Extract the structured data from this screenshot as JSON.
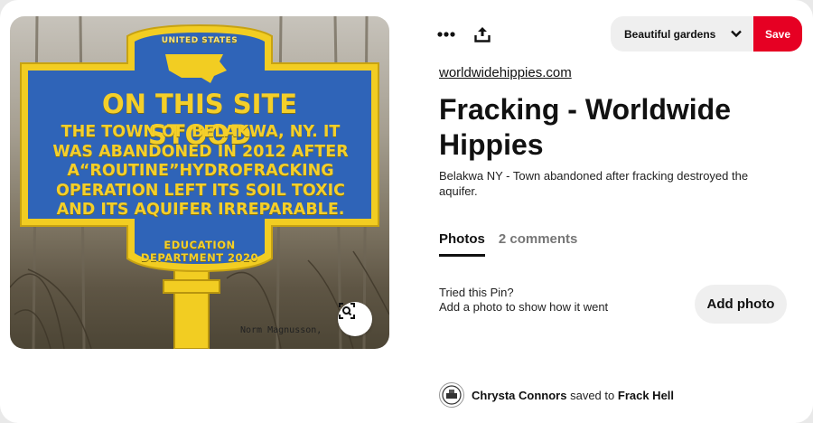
{
  "toolbar": {
    "more_icon": "more-horizontal-icon",
    "share_icon": "share-upload-icon",
    "board_name": "Beautiful gardens",
    "save_label": "Save"
  },
  "image": {
    "sign": {
      "country": "UNITED STATES",
      "title": "ON THIS SITE STOOD",
      "body": "THE TOWN OF BELAKWA, NY. IT WAS ABANDONED IN 2012 AFTER A“ROUTINE”HYDROFRACKING OPERATION LEFT ITS SOIL TOXIC AND ITS AQUIFER IRREPARABLE.",
      "department": "EDUCATION DEPARTMENT 2020"
    },
    "credit": "Norm Magnusson,",
    "lens_icon": "visual-search-icon"
  },
  "pin": {
    "source": "worldwidehippies.com",
    "title": "Fracking - Worldwide Hippies",
    "description": "Belakwa NY - Town abandoned after fracking destroyed the aquifer."
  },
  "tabs": [
    {
      "label": "Photos",
      "active": true
    },
    {
      "label": "2 comments",
      "active": false
    }
  ],
  "tried": {
    "question": "Tried this Pin?",
    "prompt": "Add a photo to show how it went",
    "button": "Add photo"
  },
  "saver": {
    "name": "Chrysta Connors",
    "action": "saved to",
    "board": "Frack Hell"
  },
  "colors": {
    "save_red": "#e60023",
    "sign_blue": "#2f64b8",
    "sign_yellow": "#f4cf2a"
  }
}
